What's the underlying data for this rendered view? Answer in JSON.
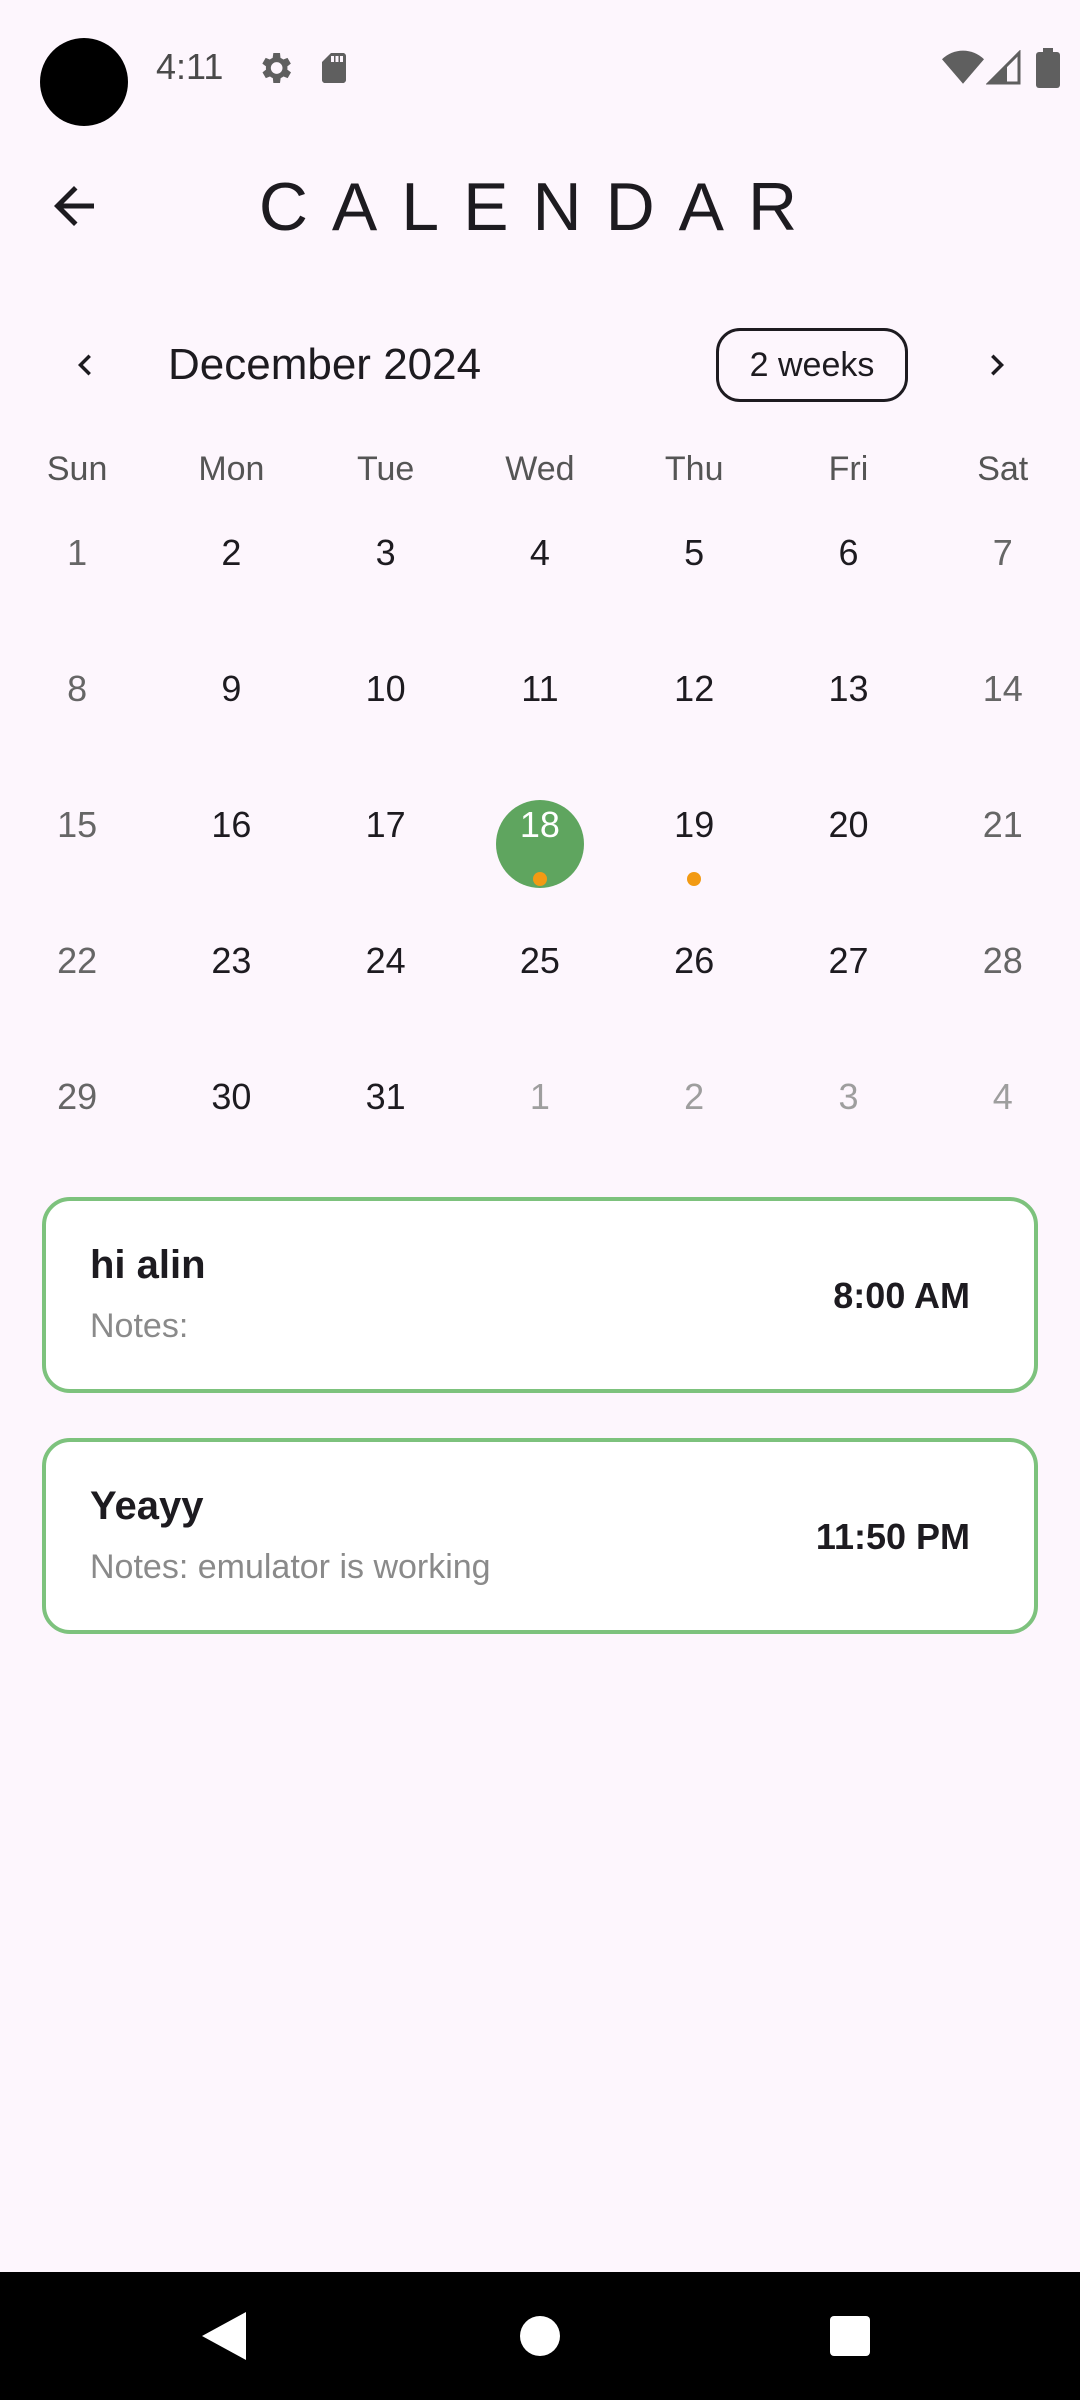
{
  "status_bar": {
    "time": "4:11"
  },
  "header": {
    "title": "CALENDAR"
  },
  "month_nav": {
    "month_label": "December 2024",
    "format_button": "2 weeks"
  },
  "days_of_week": [
    "Sun",
    "Mon",
    "Tue",
    "Wed",
    "Thu",
    "Fri",
    "Sat"
  ],
  "weeks": [
    [
      "1",
      "2",
      "3",
      "4",
      "5",
      "6",
      "7"
    ],
    [
      "8",
      "9",
      "10",
      "11",
      "12",
      "13",
      "14"
    ],
    [
      "15",
      "16",
      "17",
      "18",
      "19",
      "20",
      "21"
    ],
    [
      "22",
      "23",
      "24",
      "25",
      "26",
      "27",
      "28"
    ],
    [
      "29",
      "30",
      "31",
      "1",
      "2",
      "3",
      "4"
    ]
  ],
  "selected_day": "18",
  "event_marker_days": [
    "18",
    "19"
  ],
  "events": [
    {
      "title": "hi alin",
      "notes": "Notes:",
      "time": "8:00 AM"
    },
    {
      "title": "Yeayy",
      "notes": "Notes: emulator is working",
      "time": "11:50 PM"
    }
  ],
  "colors": {
    "background": "#fdf6fd",
    "selected_day": "#5fa55f",
    "event_marker": "#f29a13",
    "card_border": "#7dc27d"
  }
}
